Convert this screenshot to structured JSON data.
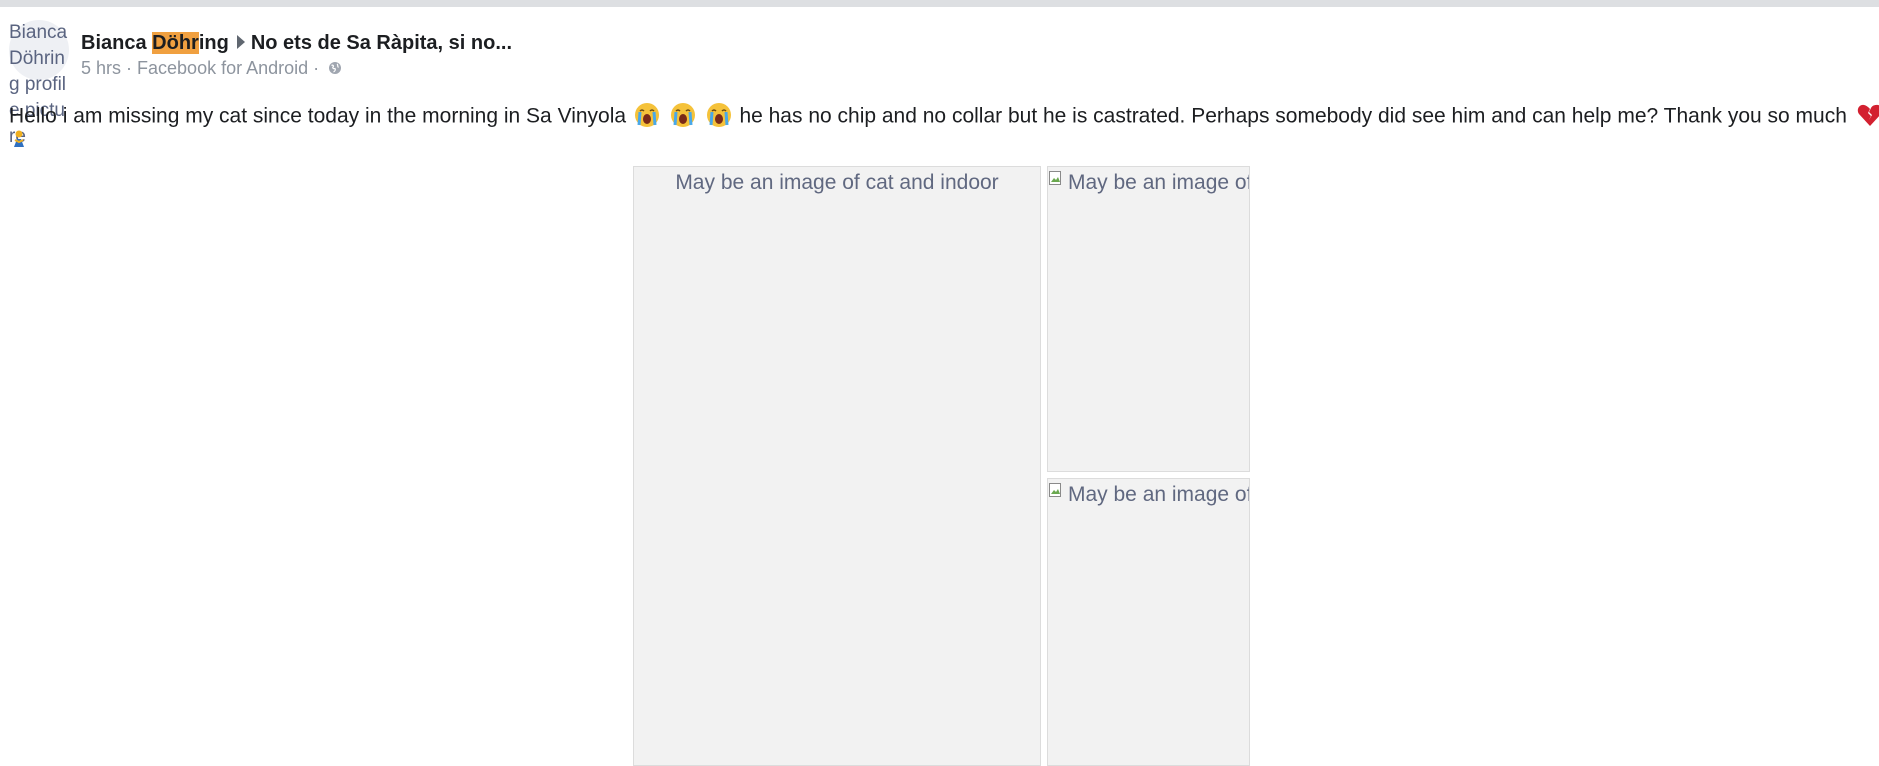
{
  "post": {
    "avatar_alt": "Bianca Döhring profile picture",
    "author": {
      "pre": "Bianca ",
      "highlight": "Döhr",
      "post": "ing"
    },
    "group": "No ets de Sa Ràpita, si no...",
    "meta": {
      "time": "5 hrs",
      "sep1": " · ",
      "source": "Facebook for Android",
      "sep2": " · "
    },
    "text": {
      "part1": "Hello i am missing my cat since today in the morning in Sa Vinyola",
      "part2": "he has no chip and no collar but he is castrated. Perhaps somebody did see him and can help me? Thank you so much"
    },
    "photos": [
      {
        "alt": "May be an image of cat and indoor"
      },
      {
        "alt": "May be an image of cat"
      },
      {
        "alt": "May be an image of cat"
      }
    ]
  },
  "icons": {
    "privacy": "globe-icon",
    "emoji": "loudly-crying-face-icon",
    "end": "broken-heart-icon",
    "broken_image": "broken-image-icon"
  },
  "colors": {
    "highlight": "#f0a040",
    "meta_text": "#8d949e",
    "alt_text": "#606880",
    "photo_bg": "#f2f2f2",
    "broken_heart": "#d32030"
  }
}
